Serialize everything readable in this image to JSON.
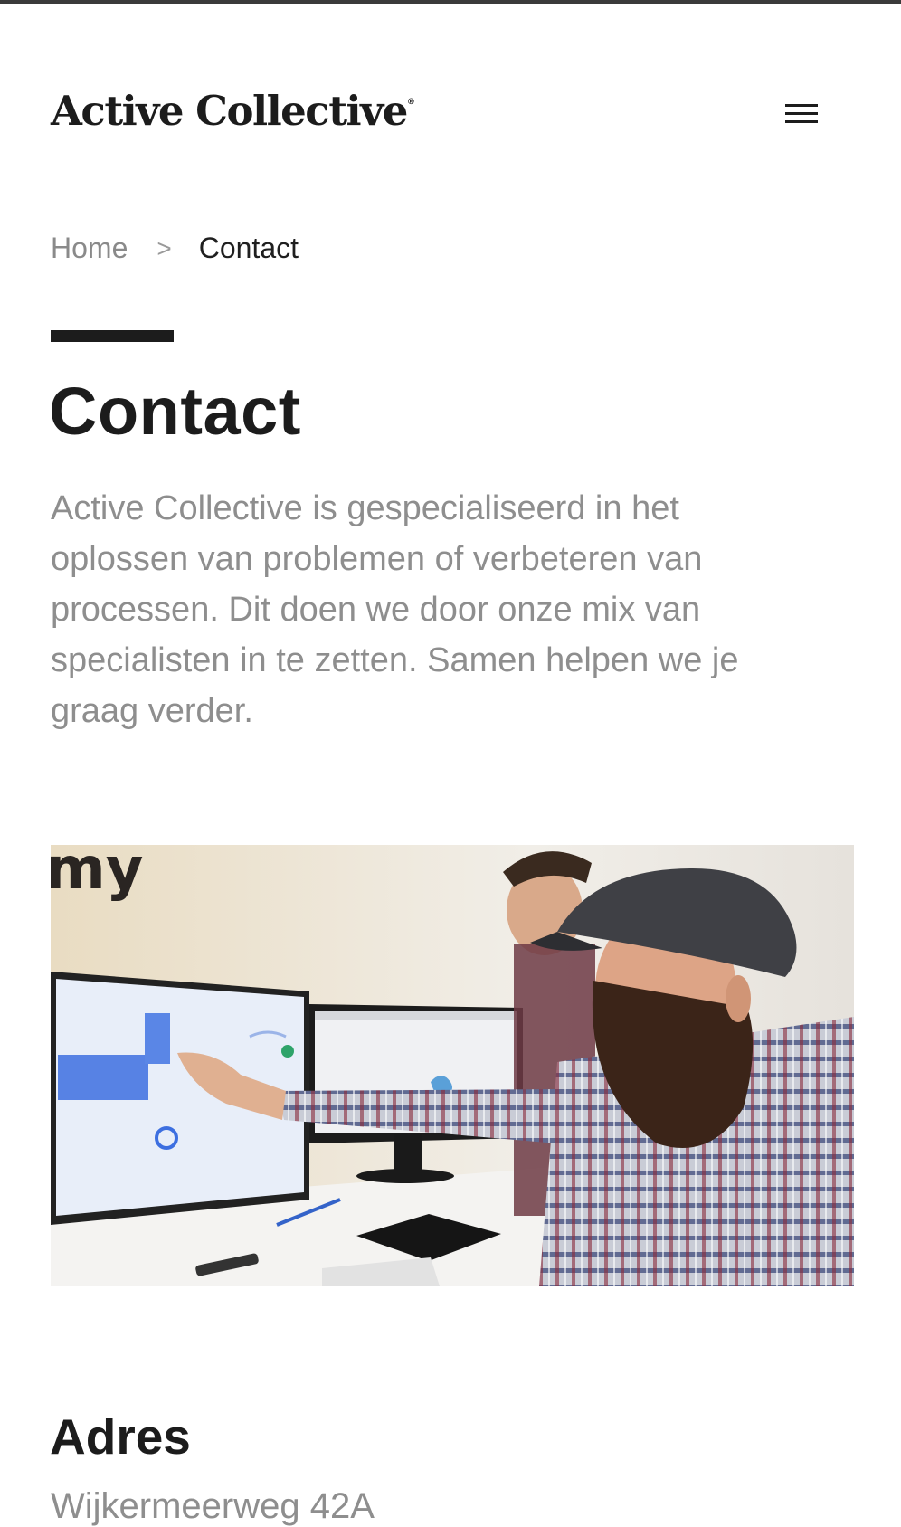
{
  "header": {
    "logo_text": "Active Collective",
    "logo_mark": "®",
    "menu_icon": "hamburger-menu-icon"
  },
  "breadcrumb": {
    "home": "Home",
    "separator": ">",
    "current": "Contact"
  },
  "page": {
    "title": "Contact",
    "intro": "Active Collective is gespecialiseerd in het oplossen van problemen of verbeteren van processen. Dit doen we door onze mix van specialisten in te zetten. Samen helpen we je graag verder."
  },
  "address": {
    "heading": "Adres",
    "line1": "Wijkermeerweg 42A"
  },
  "colors": {
    "text_dark": "#1c1c1c",
    "text_muted": "#8e8e8e",
    "accent_bar": "#1c1c1c"
  }
}
